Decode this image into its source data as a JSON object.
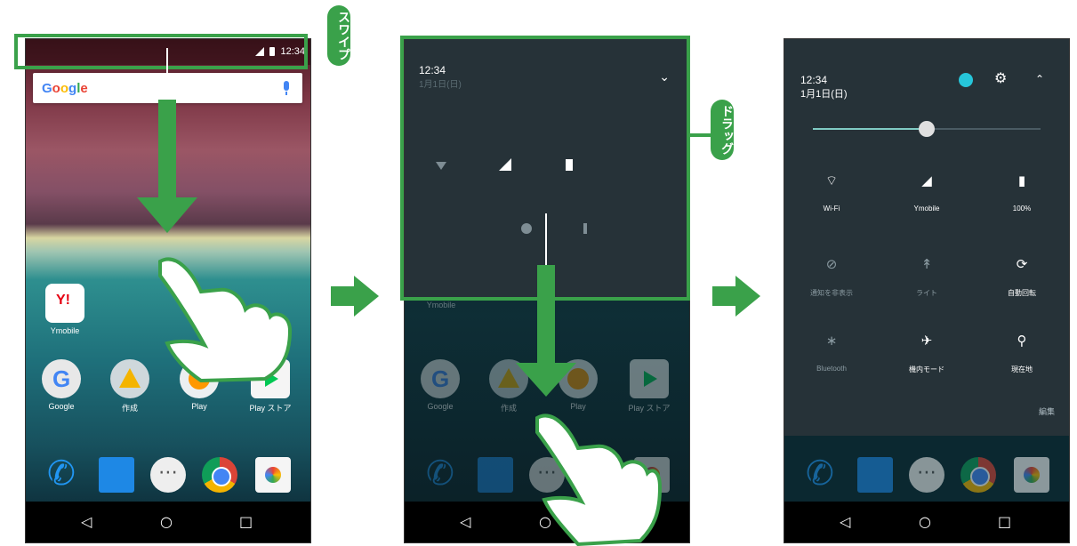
{
  "phone1": {
    "status": {
      "time": "12:34"
    },
    "search": {
      "logo_letters": [
        "G",
        "o",
        "o",
        "g",
        "l",
        "e"
      ]
    },
    "apps_row1": [
      {
        "label": "Ymobile",
        "icon": "ymobile-icon"
      }
    ],
    "apps_row2": [
      {
        "label": "Google",
        "icon": "google-icon"
      },
      {
        "label": "作成",
        "icon": "drive-icon"
      },
      {
        "label": "Play",
        "icon": "play-games-icon"
      },
      {
        "label": "Play ストア",
        "icon": "play-store-icon"
      }
    ],
    "dock": [
      "phone-icon",
      "messages-icon",
      "apps-drawer-icon",
      "chrome-icon",
      "camera-icon"
    ],
    "nav": {
      "back": "◁",
      "home": "○",
      "recents": "□"
    },
    "callout": "スワイプ"
  },
  "phone2": {
    "shade": {
      "time": "12:34",
      "date": "1月1日(日)",
      "expand": "⌄"
    },
    "apps_row": [
      {
        "label": "Google"
      },
      {
        "label": "作成"
      },
      {
        "label": "Play"
      },
      {
        "label": "Play ストア"
      }
    ],
    "partial_label": "Ymobile",
    "nav": {
      "back": "◁",
      "home": "○",
      "recents": "□"
    },
    "callout": "ドラッグ"
  },
  "phone3": {
    "header": {
      "time": "12:34",
      "date": "1月1日(日)",
      "collapse": "⌃"
    },
    "brightness_level": 0.5,
    "tiles": [
      {
        "label": "Wi-Fi",
        "glyph": "⌔"
      },
      {
        "label": "Ymobile",
        "glyph": "◢"
      },
      {
        "label": "100%",
        "glyph": "▮"
      },
      {
        "label": "通知を非表示",
        "glyph": "⊘"
      },
      {
        "label": "ライト",
        "glyph": "↟"
      },
      {
        "label": "自動回転",
        "glyph": "⟳"
      },
      {
        "label": "Bluetooth",
        "glyph": "∗"
      },
      {
        "label": "機内モード",
        "glyph": "✈"
      },
      {
        "label": "現在地",
        "glyph": "⚲"
      }
    ],
    "edit_label": "編集",
    "nav": {
      "back": "◁",
      "home": "○",
      "recents": "□"
    }
  },
  "colors": {
    "accent_green": "#3aa14a",
    "shade_bg": "#263238",
    "slider": "#80cbc4"
  }
}
